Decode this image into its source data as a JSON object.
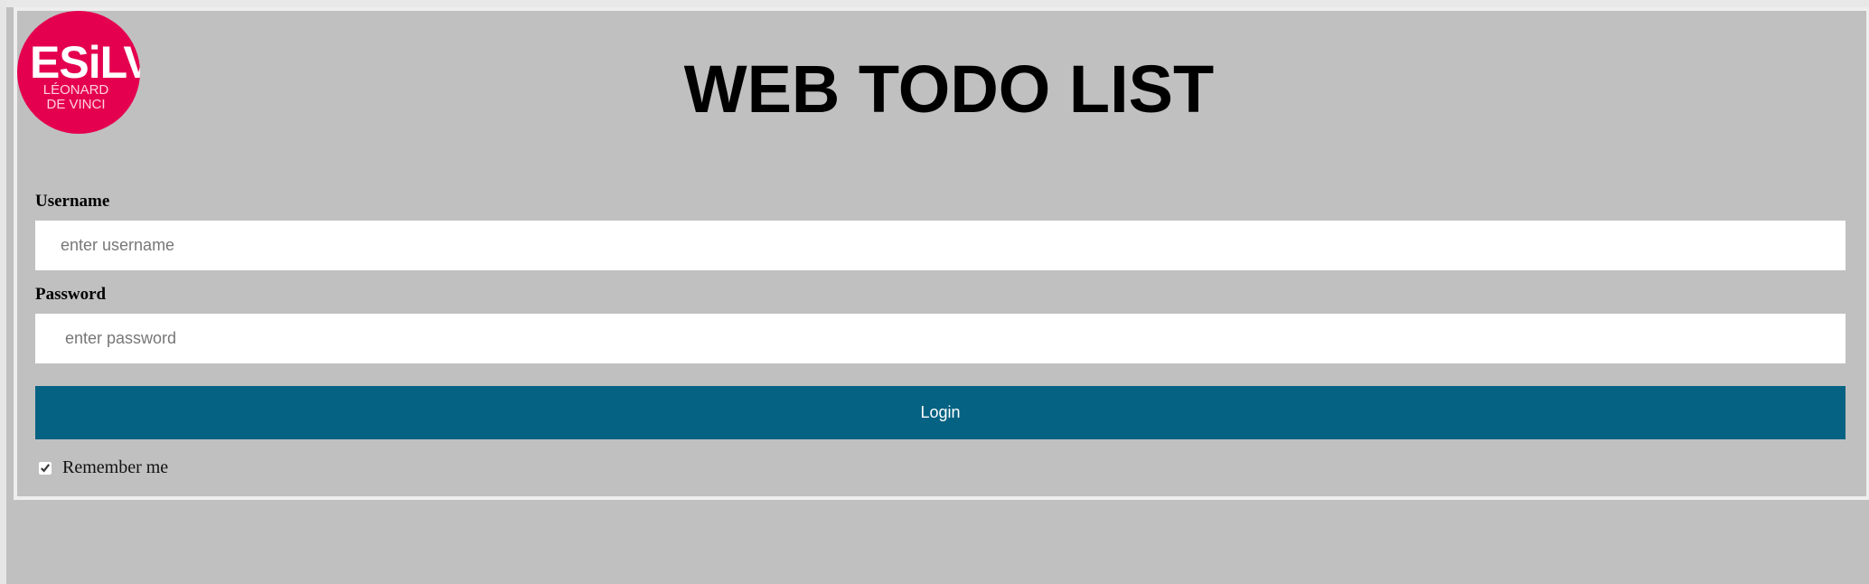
{
  "logo": {
    "main_text": "ESiLV",
    "sub_line1": "LÉONARD",
    "sub_line2": "DE VINCI",
    "color": "#e5004f"
  },
  "header": {
    "title": "WEB TODO LIST"
  },
  "form": {
    "username": {
      "label": "Username",
      "placeholder": "enter username",
      "value": ""
    },
    "password": {
      "label": "Password",
      "placeholder": "enter password",
      "value": ""
    },
    "login_label": "Login",
    "login_color": "#066282",
    "remember": {
      "label": "Remember me",
      "checked": true
    }
  }
}
